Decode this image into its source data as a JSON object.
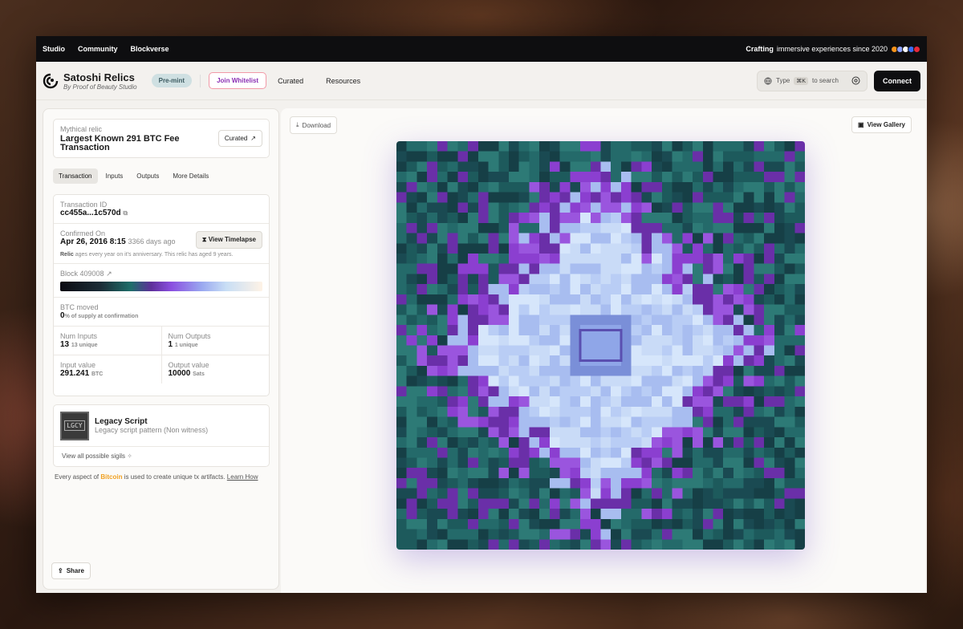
{
  "topbar": {
    "nav": [
      "Studio",
      "Community",
      "Blockverse"
    ],
    "tagline_bold": "Crafting",
    "tagline_rest": "immersive experiences since 2020"
  },
  "header": {
    "brand_title": "Satoshi Relics",
    "brand_sub": "By Proof of Beauty Studio",
    "premint": "Pre-mint",
    "whitelist": "Join Whitelist",
    "links": [
      "Curated",
      "Resources"
    ],
    "search_prefix": "Type",
    "search_kbd": "⌘K",
    "search_suffix": "to search",
    "connect": "Connect"
  },
  "relic": {
    "kind": "Mythical relic",
    "name": "Largest Known 291 BTC Fee Transaction",
    "curated": "Curated"
  },
  "tabs": [
    "Transaction",
    "Inputs",
    "Outputs",
    "More Details"
  ],
  "details": {
    "txid_label": "Transaction ID",
    "txid": "cc455a...1c570d",
    "confirmed_label": "Confirmed On",
    "confirmed_date": "Apr 26, 2016 8:15",
    "confirmed_ago": "3366 days ago",
    "timelapse": "View Timelapse",
    "age_bold": "Relic",
    "age_note": "ages every year on it's anniversary. This relic has aged 9 years.",
    "block_label": "Block 409008",
    "btc_moved_label": "BTC moved",
    "btc_moved_value": "0",
    "btc_moved_note": "% of supply at confirmation",
    "num_inputs_label": "Num Inputs",
    "num_inputs": "13",
    "num_inputs_note": "13 unique",
    "num_outputs_label": "Num Outputs",
    "num_outputs": "1",
    "num_outputs_note": "1 unique",
    "input_value_label": "Input value",
    "input_value": "291.241",
    "input_unit": "BTC",
    "output_value_label": "Output value",
    "output_value": "10000",
    "output_unit": "Sats"
  },
  "script": {
    "sigil_text": "LGCY",
    "title": "Legacy Script",
    "sub": "Legacy script pattern (Non witness)",
    "view_all": "View all possible sigils"
  },
  "footnote": {
    "prefix": "Every aspect of",
    "btc": "Bitcoin",
    "mid": "is used to create unique tx artifacts.",
    "learn": "Learn How"
  },
  "share": "Share",
  "download": "Download",
  "gallery": "View Gallery",
  "colors": {
    "accent": "#8a2fb3",
    "bitcoin": "#f0a020",
    "art_teal": "#1f5e5e",
    "art_purple": "#8b3fd0",
    "art_light": "#c9dbf7"
  }
}
